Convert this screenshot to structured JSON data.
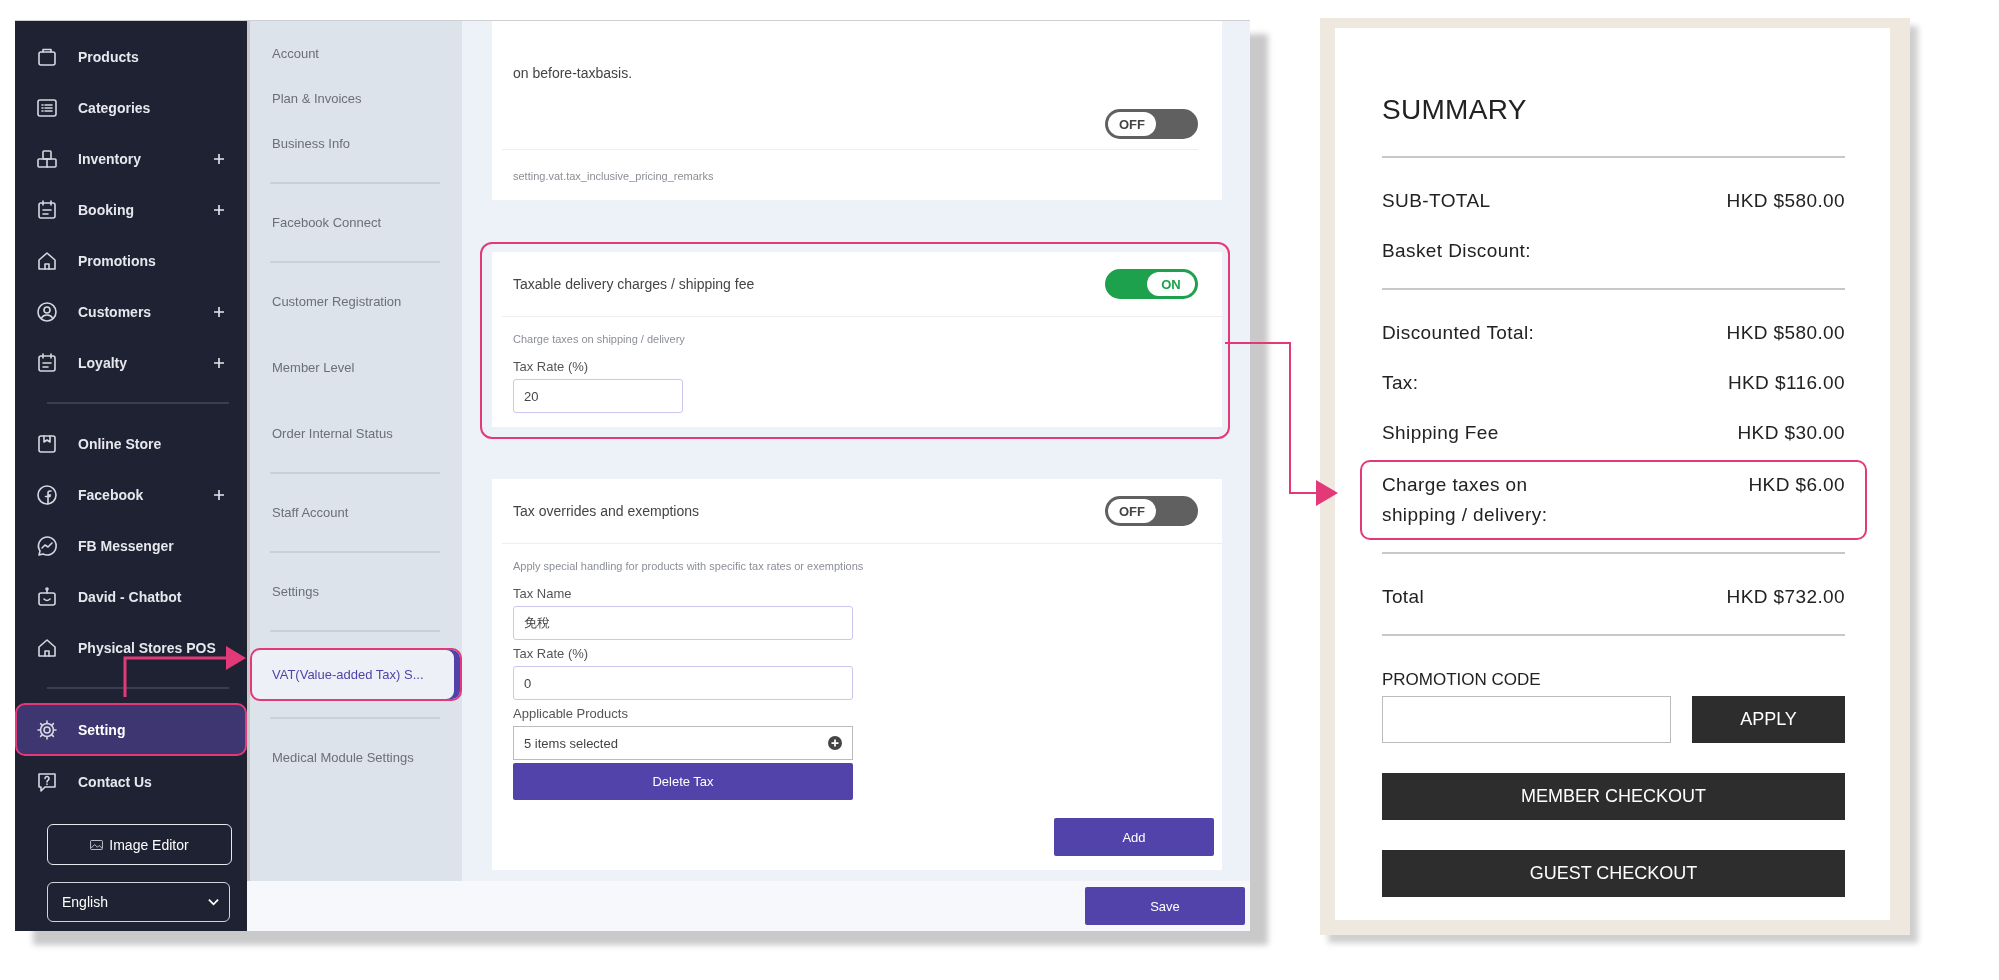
{
  "sidebar": {
    "groups": [
      {
        "items": [
          {
            "label": "Products",
            "kind": "bag",
            "expandable": false,
            "selected": false,
            "highlighted": false
          },
          {
            "label": "Categories",
            "kind": "list",
            "expandable": false,
            "selected": false,
            "highlighted": false
          },
          {
            "label": "Inventory",
            "kind": "boxes",
            "expandable": true,
            "selected": false,
            "highlighted": false
          },
          {
            "label": "Booking",
            "kind": "calendar",
            "expandable": true,
            "selected": false,
            "highlighted": false
          },
          {
            "label": "Promotions",
            "kind": "house",
            "expandable": false,
            "selected": false,
            "highlighted": false
          },
          {
            "label": "Customers",
            "kind": "user",
            "expandable": true,
            "selected": false,
            "highlighted": false
          },
          {
            "label": "Loyalty",
            "kind": "calendar",
            "expandable": true,
            "selected": false,
            "highlighted": false
          }
        ]
      },
      {
        "items": [
          {
            "label": "Online Store",
            "kind": "store",
            "expandable": false,
            "selected": false,
            "highlighted": false
          },
          {
            "label": "Facebook",
            "kind": "facebook",
            "expandable": true,
            "selected": false,
            "highlighted": false
          },
          {
            "label": "FB Messenger",
            "kind": "messenger",
            "expandable": false,
            "selected": false,
            "highlighted": false
          },
          {
            "label": "David - Chatbot",
            "kind": "robot",
            "expandable": false,
            "selected": false,
            "highlighted": false
          },
          {
            "label": "Physical Stores POS",
            "kind": "house",
            "expandable": false,
            "selected": false,
            "highlighted": false
          }
        ]
      },
      {
        "items": [
          {
            "label": "Setting",
            "kind": "gear",
            "expandable": false,
            "selected": true,
            "highlighted": true
          },
          {
            "label": "Contact Us",
            "kind": "question",
            "expandable": false,
            "selected": false,
            "highlighted": false
          }
        ]
      }
    ],
    "image_editor_button": "Image Editor",
    "language_select": "English"
  },
  "sub_menu": {
    "groups": [
      {
        "items": [
          {
            "label": "Account",
            "selected": false,
            "highlighted": false
          },
          {
            "label": "Plan & Invoices",
            "selected": false,
            "highlighted": false
          },
          {
            "label": "Business Info",
            "selected": false,
            "highlighted": false
          }
        ]
      },
      {
        "items": [
          {
            "label": "Facebook Connect",
            "selected": false,
            "highlighted": false
          }
        ]
      },
      {
        "items": [
          {
            "label": "Customer Registration",
            "selected": false,
            "highlighted": false
          },
          {
            "label": "Member Level",
            "selected": false,
            "highlighted": false
          },
          {
            "label": "Order Internal Status",
            "selected": false,
            "highlighted": false
          }
        ]
      },
      {
        "items": [
          {
            "label": "Staff Account",
            "selected": false,
            "highlighted": false
          }
        ]
      },
      {
        "items": [
          {
            "label": "Settings",
            "selected": false,
            "highlighted": false
          }
        ]
      },
      {
        "items": [
          {
            "label": "VAT(Value-added Tax) S...",
            "selected": true,
            "highlighted": true
          }
        ]
      },
      {
        "items": [
          {
            "label": "Medical Module Settings",
            "selected": false,
            "highlighted": false
          }
        ]
      }
    ]
  },
  "cards": [
    {
      "kind": "note",
      "text": "on before-taxbasis.",
      "toggle": {
        "on": false,
        "label": "OFF"
      },
      "remark": "setting.vat.tax_inclusive_pricing_remarks",
      "highlighted": false
    },
    {
      "kind": "section",
      "title": "Taxable delivery charges / shipping fee",
      "toggle": {
        "on": true,
        "label": "ON"
      },
      "description": "Charge taxes on shipping / delivery",
      "fields": [
        {
          "kind": "text",
          "label": "Tax Rate (%)",
          "value": "20"
        }
      ],
      "highlighted": true
    },
    {
      "kind": "section",
      "title": "Tax overrides and exemptions",
      "toggle": {
        "on": false,
        "label": "OFF"
      },
      "description": "Apply special handling for products with specific tax rates or exemptions",
      "fields": [
        {
          "kind": "text",
          "label": "Tax Name",
          "value": "免稅"
        },
        {
          "kind": "text",
          "label": "Tax Rate (%)",
          "value": "0"
        },
        {
          "kind": "select",
          "label": "Applicable Products",
          "value": "5 items selected"
        }
      ],
      "delete_button": "Delete Tax",
      "add_button": "Add",
      "highlighted": false
    }
  ],
  "save_button": "Save",
  "summary": {
    "title": "SUMMARY",
    "groups": [
      {
        "rows": [
          {
            "label": "SUB-TOTAL",
            "value": "HKD $580.00",
            "highlighted": false
          },
          {
            "label": "Basket Discount:",
            "highlighted": false
          }
        ]
      },
      {
        "rows": [
          {
            "label": "Discounted Total:",
            "value": "HKD $580.00",
            "highlighted": false
          },
          {
            "label": "Tax:",
            "value": "HKD $116.00",
            "highlighted": false
          },
          {
            "label": "Shipping Fee",
            "value": "HKD $30.00",
            "highlighted": false
          },
          {
            "label": "Charge taxes on shipping / delivery:",
            "value": "HKD $6.00",
            "highlighted": true
          }
        ]
      },
      {
        "rows": [
          {
            "label": "Total",
            "value": "HKD $732.00",
            "highlighted": false
          }
        ]
      }
    ],
    "promotion_label": "PROMOTION CODE",
    "apply_button": "APPLY",
    "member_checkout_button": "MEMBER CHECKOUT",
    "guest_checkout_button": "GUEST CHECKOUT"
  }
}
